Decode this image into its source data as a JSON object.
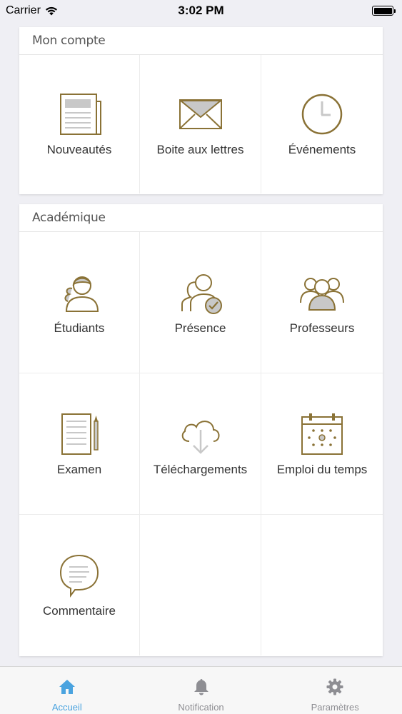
{
  "status_bar": {
    "carrier": "Carrier",
    "time": "3:02 PM",
    "battery_level": 1.0
  },
  "sections": [
    {
      "title": "Mon compte",
      "tiles": [
        {
          "label": "Nouveautés",
          "icon": "newspaper-icon"
        },
        {
          "label": "Boite aux lettres",
          "icon": "envelope-icon"
        },
        {
          "label": "Événements",
          "icon": "clock-icon"
        }
      ]
    },
    {
      "title": "Académique",
      "tiles": [
        {
          "label": "Étudiants",
          "icon": "students-icon"
        },
        {
          "label": "Présence",
          "icon": "attendance-icon"
        },
        {
          "label": "Professeurs",
          "icon": "teachers-icon"
        },
        {
          "label": "Examen",
          "icon": "exam-icon"
        },
        {
          "label": "Téléchargements",
          "icon": "cloud-download-icon"
        },
        {
          "label": "Emploi du temps",
          "icon": "calendar-icon"
        },
        {
          "label": "Commentaire",
          "icon": "comment-icon"
        }
      ]
    }
  ],
  "tab_bar": {
    "tabs": [
      {
        "label": "Accueil",
        "icon": "home-icon",
        "active": true
      },
      {
        "label": "Notification",
        "icon": "bell-icon",
        "active": false
      },
      {
        "label": "Paramètres",
        "icon": "gear-icon",
        "active": false
      }
    ]
  },
  "colors": {
    "icon_gold": "#8a7236",
    "icon_gray": "#c8c8c8",
    "active_tab": "#4aa3df",
    "inactive_tab": "#8e8e93",
    "background": "#efeff4"
  }
}
